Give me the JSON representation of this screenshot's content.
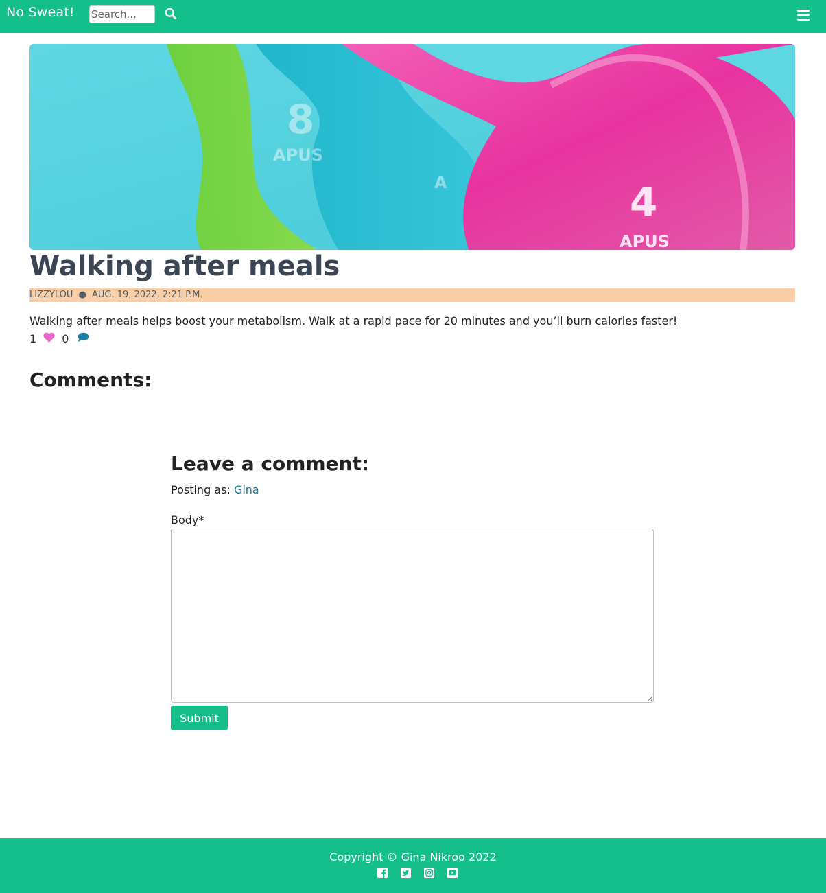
{
  "navbar": {
    "brand": "No Sweat!",
    "search_placeholder": "Search...",
    "search_icon": "search-icon",
    "menu_icon": "hamburger-menu-icon",
    "color": "#14bf8c"
  },
  "post": {
    "hero_image": "kettlebells-photo",
    "title": "Walking after meals",
    "author": "lizzylou",
    "separator": "●",
    "date": "Aug. 19, 2022, 2:21 p.m.",
    "body": "Walking after meals helps boost your metabolism. Walk at a rapid pace for 20 minutes and you’ll burn calories faster!",
    "likes": "1",
    "comments_count": "0",
    "like_icon": "heart-icon",
    "comment_icon": "comment-icon",
    "like_color": "#ea66c9",
    "comment_color": "#1a7fa0"
  },
  "comments": {
    "heading": "Comments:"
  },
  "comment_form": {
    "heading": "Leave a comment:",
    "posting_as_label": "Posting as:",
    "username": "Gina",
    "body_label": "Body*",
    "submit_label": "Submit"
  },
  "footer": {
    "copyright": "Copyright © Gina Nikroo 2022",
    "social_icons": [
      "facebook-icon",
      "twitter-icon",
      "instagram-icon",
      "youtube-icon"
    ]
  }
}
